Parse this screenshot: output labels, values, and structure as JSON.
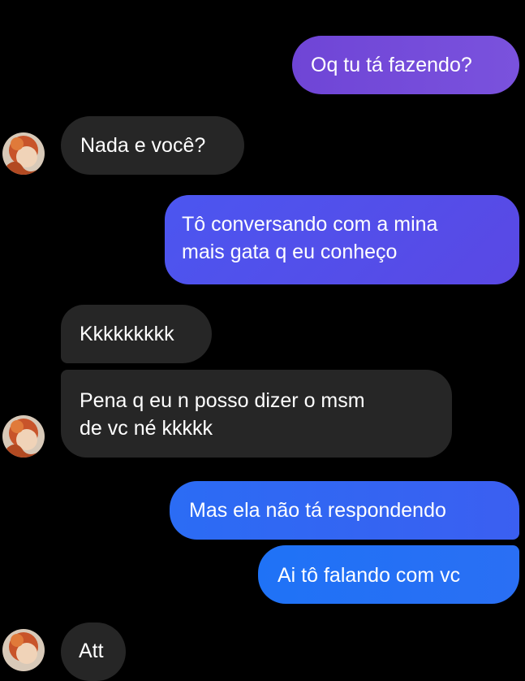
{
  "conversation": {
    "messages": [
      {
        "side": "sent",
        "text": "Oq tu tá fazendo?"
      },
      {
        "side": "received",
        "text": "Nada e você?"
      },
      {
        "side": "sent",
        "line1": "Tô conversando com a mina",
        "line2": "mais gata q eu conheço"
      },
      {
        "side": "received",
        "text": "Kkkkkkkkk"
      },
      {
        "side": "received",
        "line1": "Pena q eu n posso dizer o msm",
        "line2": "de vc né kkkkk"
      },
      {
        "side": "sent",
        "text": "Mas ela não tá respondendo"
      },
      {
        "side": "sent",
        "text": "Ai tô falando com vc"
      },
      {
        "side": "received",
        "text": "Att"
      }
    ]
  },
  "colors": {
    "background": "#000000",
    "received_bubble": "#262626",
    "sent_purple": "#7a52dd",
    "sent_indigo": "#4b56f0",
    "sent_blue": "#2b6cf4"
  },
  "icons": {
    "contact_avatar": "contact-avatar-icon"
  }
}
